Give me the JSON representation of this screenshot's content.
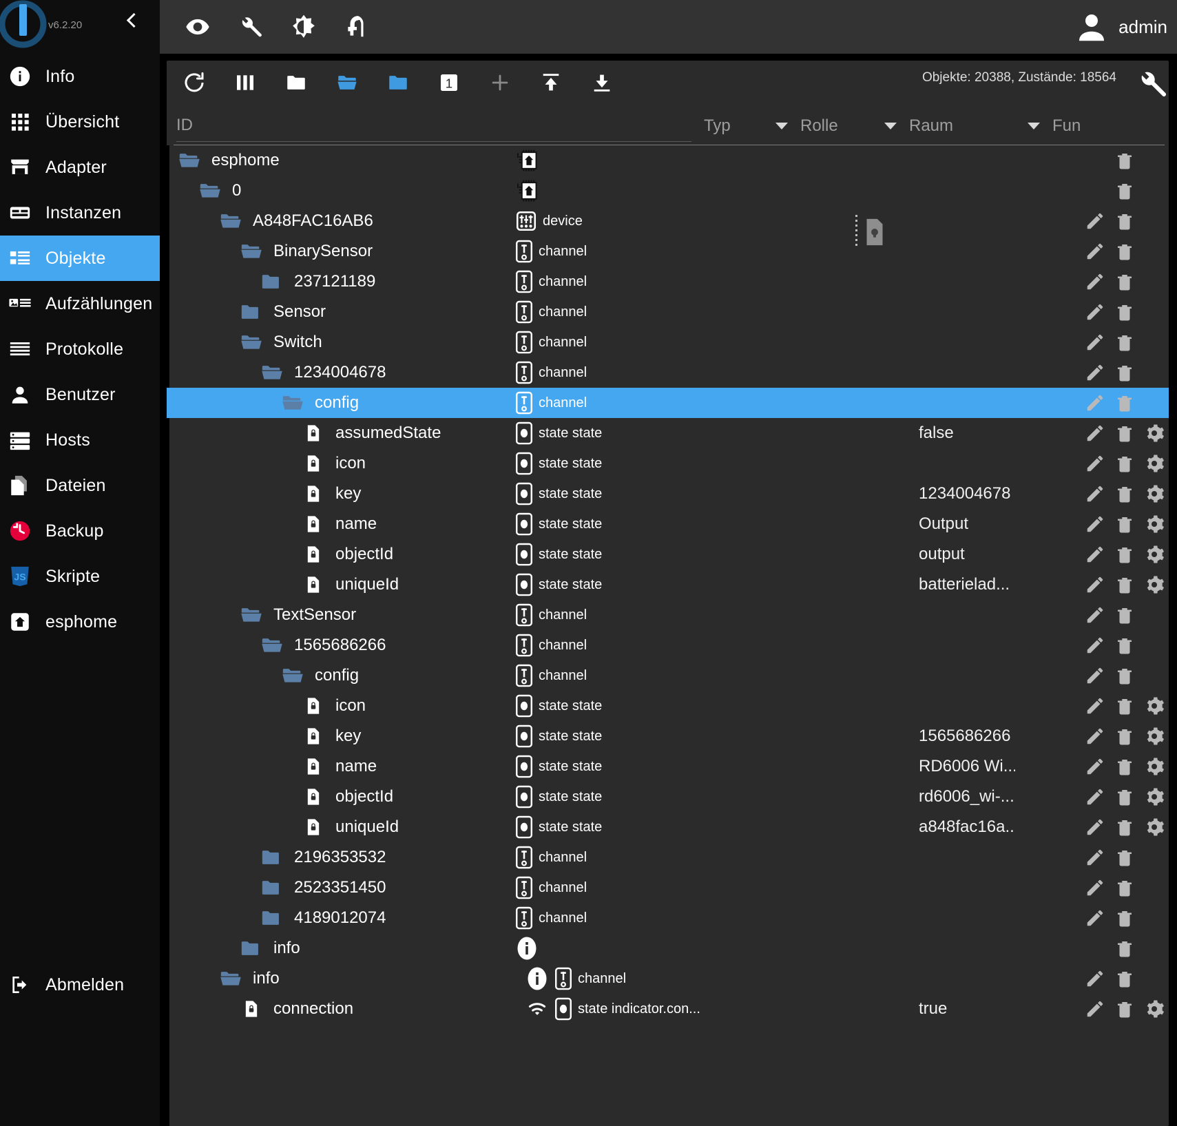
{
  "app": {
    "version": "v6.2.20",
    "user": "admin"
  },
  "sidebar": {
    "items": [
      {
        "label": "Info",
        "icon": "info-icon",
        "active": false
      },
      {
        "label": "Übersicht",
        "icon": "grid-icon",
        "active": false
      },
      {
        "label": "Adapter",
        "icon": "store-icon",
        "active": false
      },
      {
        "label": "Instanzen",
        "icon": "instances-icon",
        "active": false
      },
      {
        "label": "Objekte",
        "icon": "list-icon",
        "active": true
      },
      {
        "label": "Aufzählungen",
        "icon": "enums-icon",
        "active": false
      },
      {
        "label": "Protokolle",
        "icon": "logs-icon",
        "active": false
      },
      {
        "label": "Benutzer",
        "icon": "user-icon",
        "active": false
      },
      {
        "label": "Hosts",
        "icon": "hosts-icon",
        "active": false
      },
      {
        "label": "Dateien",
        "icon": "files-icon",
        "active": false
      },
      {
        "label": "Backup",
        "icon": "backup-icon",
        "active": false
      },
      {
        "label": "Skripte",
        "icon": "javascript-icon",
        "active": false
      },
      {
        "label": "esphome",
        "icon": "esphome-icon",
        "active": false
      }
    ],
    "logout": {
      "label": "Abmelden",
      "icon": "logout-icon"
    }
  },
  "topbar": {
    "icons": [
      "eye-icon",
      "wrench-icon",
      "brightness-icon",
      "expert-head-icon"
    ]
  },
  "toolbar": {
    "buttons": [
      "refresh-icon",
      "columns-icon",
      "folder-closed-icon",
      "folder-open-icon",
      "folder-filled-icon",
      "depth-one-icon",
      "plus-icon",
      "upload-icon",
      "download-icon"
    ],
    "counts": "Objekte: 20388, Zustände: 18564",
    "settings_icon": "wrench-icon"
  },
  "filters": {
    "id_placeholder": "ID",
    "typ": "Typ",
    "rolle": "Rolle",
    "raum": "Raum",
    "funktion": "Fun"
  },
  "colors": {
    "accent": "#45a7ef",
    "folder": "#5b7fa6",
    "sidebar_bg": "#0e0e0e",
    "panel_bg": "#2b2b2b",
    "topbar_bg": "#333333"
  },
  "tree": {
    "rows": [
      {
        "name": "esphome",
        "indent": 0,
        "kind": "folder-open",
        "type": "",
        "typeicon": "chip-house-icon",
        "value": "",
        "edit": false,
        "del": true,
        "gear": false,
        "selected": false
      },
      {
        "name": "0",
        "indent": 1,
        "kind": "folder-open",
        "type": "",
        "typeicon": "chip-house-icon",
        "value": "",
        "edit": false,
        "del": true,
        "gear": false,
        "selected": false
      },
      {
        "name": "A848FAC16AB6",
        "indent": 2,
        "kind": "folder-open",
        "type": "device",
        "typeicon": "device-icon",
        "value": "",
        "edit": true,
        "del": true,
        "gear": false,
        "selected": false
      },
      {
        "name": "BinarySensor",
        "indent": 3,
        "kind": "folder-open",
        "type": "channel",
        "typeicon": "channel-icon",
        "value": "",
        "edit": true,
        "del": true,
        "gear": false,
        "selected": false
      },
      {
        "name": "237121189",
        "indent": 4,
        "kind": "folder-closed",
        "type": "channel",
        "typeicon": "channel-icon",
        "value": "",
        "edit": true,
        "del": true,
        "gear": false,
        "selected": false
      },
      {
        "name": "Sensor",
        "indent": 3,
        "kind": "folder-closed",
        "type": "channel",
        "typeicon": "channel-icon",
        "value": "",
        "edit": true,
        "del": true,
        "gear": false,
        "selected": false
      },
      {
        "name": "Switch",
        "indent": 3,
        "kind": "folder-open",
        "type": "channel",
        "typeicon": "channel-icon",
        "value": "",
        "edit": true,
        "del": true,
        "gear": false,
        "selected": false
      },
      {
        "name": "1234004678",
        "indent": 4,
        "kind": "folder-open",
        "type": "channel",
        "typeicon": "channel-icon",
        "value": "",
        "edit": true,
        "del": true,
        "gear": false,
        "selected": false
      },
      {
        "name": "config",
        "indent": 5,
        "kind": "folder-open",
        "type": "channel",
        "typeicon": "channel-icon",
        "value": "",
        "edit": true,
        "del": true,
        "gear": false,
        "selected": true
      },
      {
        "name": "assumedState",
        "indent": 6,
        "kind": "state-doc",
        "type": "state state",
        "typeicon": "state-icon",
        "value": "false",
        "edit": true,
        "del": true,
        "gear": true,
        "selected": false
      },
      {
        "name": "icon",
        "indent": 6,
        "kind": "state-doc",
        "type": "state state",
        "typeicon": "state-icon",
        "value": "",
        "edit": true,
        "del": true,
        "gear": true,
        "selected": false
      },
      {
        "name": "key",
        "indent": 6,
        "kind": "state-doc",
        "type": "state state",
        "typeicon": "state-icon",
        "value": "1234004678",
        "edit": true,
        "del": true,
        "gear": true,
        "selected": false
      },
      {
        "name": "name",
        "indent": 6,
        "kind": "state-doc",
        "type": "state state",
        "typeicon": "state-icon",
        "value": "Output",
        "edit": true,
        "del": true,
        "gear": true,
        "selected": false
      },
      {
        "name": "objectId",
        "indent": 6,
        "kind": "state-doc",
        "type": "state state",
        "typeicon": "state-icon",
        "value": "output",
        "edit": true,
        "del": true,
        "gear": true,
        "selected": false
      },
      {
        "name": "uniqueId",
        "indent": 6,
        "kind": "state-doc",
        "type": "state state",
        "typeicon": "state-icon",
        "value": "batterielad...",
        "edit": true,
        "del": true,
        "gear": true,
        "selected": false
      },
      {
        "name": "TextSensor",
        "indent": 3,
        "kind": "folder-open",
        "type": "channel",
        "typeicon": "channel-icon",
        "value": "",
        "edit": true,
        "del": true,
        "gear": false,
        "selected": false
      },
      {
        "name": "1565686266",
        "indent": 4,
        "kind": "folder-open",
        "type": "channel",
        "typeicon": "channel-icon",
        "value": "",
        "edit": true,
        "del": true,
        "gear": false,
        "selected": false
      },
      {
        "name": "config",
        "indent": 5,
        "kind": "folder-open",
        "type": "channel",
        "typeicon": "channel-icon",
        "value": "",
        "edit": true,
        "del": true,
        "gear": false,
        "selected": false
      },
      {
        "name": "icon",
        "indent": 6,
        "kind": "state-doc",
        "type": "state state",
        "typeicon": "state-icon",
        "value": "",
        "edit": true,
        "del": true,
        "gear": true,
        "selected": false
      },
      {
        "name": "key",
        "indent": 6,
        "kind": "state-doc",
        "type": "state state",
        "typeicon": "state-icon",
        "value": "1565686266",
        "edit": true,
        "del": true,
        "gear": true,
        "selected": false
      },
      {
        "name": "name",
        "indent": 6,
        "kind": "state-doc",
        "type": "state state",
        "typeicon": "state-icon",
        "value": "RD6006 Wi...",
        "edit": true,
        "del": true,
        "gear": true,
        "selected": false
      },
      {
        "name": "objectId",
        "indent": 6,
        "kind": "state-doc",
        "type": "state state",
        "typeicon": "state-icon",
        "value": "rd6006_wi-...",
        "edit": true,
        "del": true,
        "gear": true,
        "selected": false
      },
      {
        "name": "uniqueId",
        "indent": 6,
        "kind": "state-doc",
        "type": "state state",
        "typeicon": "state-icon",
        "value": "a848fac16a...",
        "edit": true,
        "del": true,
        "gear": true,
        "selected": false
      },
      {
        "name": "2196353532",
        "indent": 4,
        "kind": "folder-closed",
        "type": "channel",
        "typeicon": "channel-icon",
        "value": "",
        "edit": true,
        "del": true,
        "gear": false,
        "selected": false
      },
      {
        "name": "2523351450",
        "indent": 4,
        "kind": "folder-closed",
        "type": "channel",
        "typeicon": "channel-icon",
        "value": "",
        "edit": true,
        "del": true,
        "gear": false,
        "selected": false
      },
      {
        "name": "4189012074",
        "indent": 4,
        "kind": "folder-closed",
        "type": "channel",
        "typeicon": "channel-icon",
        "value": "",
        "edit": true,
        "del": true,
        "gear": false,
        "selected": false
      },
      {
        "name": "info",
        "indent": 3,
        "kind": "folder-closed",
        "type": "",
        "typeicon": "info-circle-icon",
        "value": "",
        "edit": false,
        "del": true,
        "gear": false,
        "selected": false
      },
      {
        "name": "info",
        "indent": 2,
        "kind": "folder-open",
        "type": "channel",
        "typeicon": "info-circle-channel-icon",
        "value": "",
        "edit": true,
        "del": true,
        "gear": false,
        "selected": false
      },
      {
        "name": "connection",
        "indent": 3,
        "kind": "state-doc",
        "type": "state indicator.con...",
        "typeicon": "wifi-state-icon",
        "value": "true",
        "edit": true,
        "del": true,
        "gear": true,
        "selected": false
      }
    ]
  }
}
